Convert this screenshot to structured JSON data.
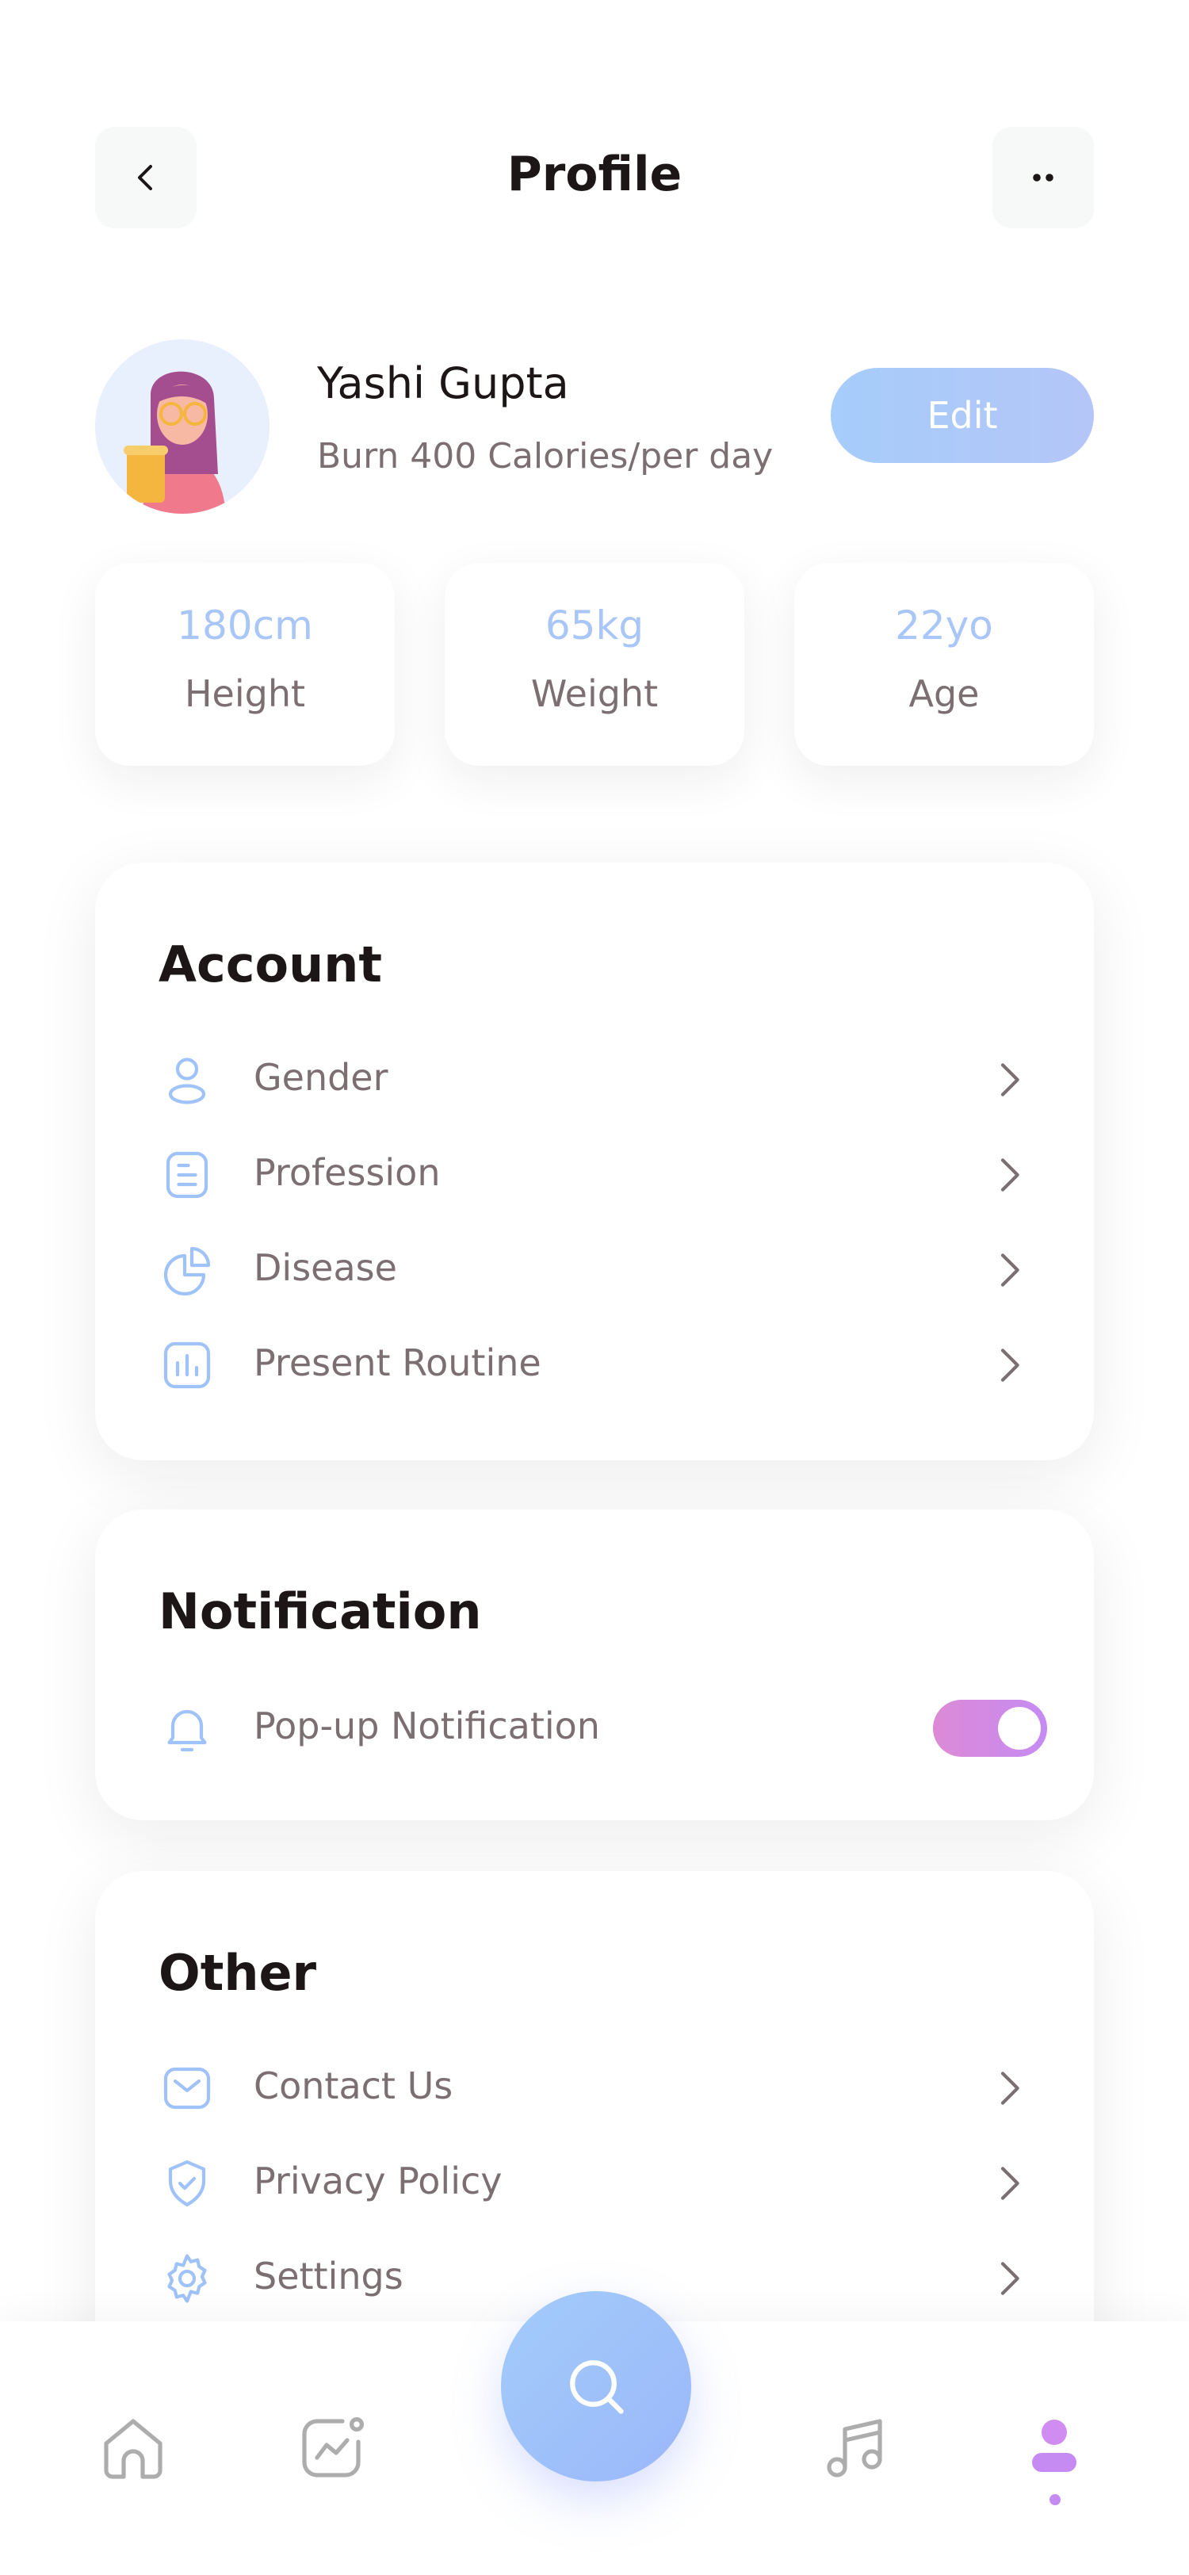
{
  "header": {
    "title": "Profile"
  },
  "profile": {
    "name": "Yashi Gupta",
    "goal": "Burn 400 Calories/per day",
    "edit_label": "Edit"
  },
  "stats": [
    {
      "value": "180cm",
      "label": "Height"
    },
    {
      "value": "65kg",
      "label": "Weight"
    },
    {
      "value": "22yo",
      "label": "Age"
    }
  ],
  "account": {
    "title": "Account",
    "items": [
      {
        "label": "Gender",
        "icon": "user-icon"
      },
      {
        "label": "Profession",
        "icon": "document-icon"
      },
      {
        "label": "Disease",
        "icon": "pie-chart-icon"
      },
      {
        "label": "Present Routine",
        "icon": "bar-chart-icon"
      }
    ]
  },
  "notification": {
    "title": "Notification",
    "items": [
      {
        "label": "Pop-up Notification",
        "icon": "bell-icon",
        "enabled": true
      }
    ]
  },
  "other": {
    "title": "Other",
    "items": [
      {
        "label": "Contact Us",
        "icon": "mail-icon"
      },
      {
        "label": "Privacy Policy",
        "icon": "shield-icon"
      },
      {
        "label": "Settings",
        "icon": "gear-icon"
      }
    ]
  },
  "bottom_nav": {
    "items": [
      "home-icon",
      "activity-icon",
      "search-icon",
      "music-icon",
      "profile-icon"
    ],
    "active": "profile-icon"
  },
  "colors": {
    "accent_blue": "#A9C6F8",
    "accent_purple": "#C58BF2",
    "text_dark": "#1D1617",
    "text_gray": "#7B6F72"
  }
}
